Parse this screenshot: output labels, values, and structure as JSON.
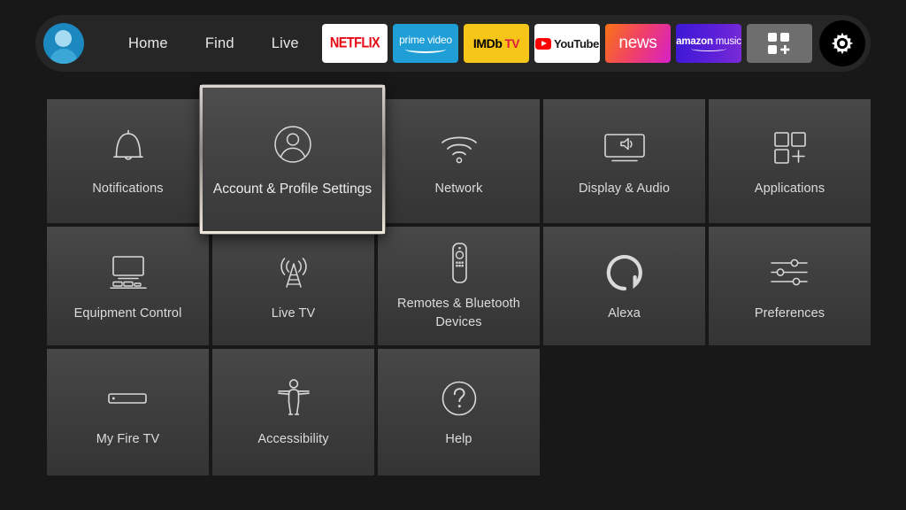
{
  "nav": {
    "avatar_name": "profile-avatar",
    "links": [
      {
        "label": "Home"
      },
      {
        "label": "Find"
      },
      {
        "label": "Live"
      }
    ],
    "apps": [
      {
        "name": "netflix",
        "label": "NETFLIX"
      },
      {
        "name": "prime-video",
        "label": "prime video"
      },
      {
        "name": "imdb-tv",
        "label_a": "IMDb",
        "label_b": "TV"
      },
      {
        "name": "youtube",
        "label": "YouTube"
      },
      {
        "name": "news",
        "label": "news"
      },
      {
        "name": "amazon-music",
        "label_a": "amazon",
        "label_b": "music"
      },
      {
        "name": "app-library",
        "label": ""
      },
      {
        "name": "settings-gear",
        "label": ""
      }
    ]
  },
  "grid": {
    "rows": [
      [
        {
          "icon": "bell-icon",
          "label": "Notifications"
        },
        {
          "icon": "person-circle-icon",
          "label": "Account & Profile Settings",
          "selected": true
        },
        {
          "icon": "wifi-icon",
          "label": "Network"
        },
        {
          "icon": "tv-speaker-icon",
          "label": "Display & Audio"
        },
        {
          "icon": "apps-grid-plus-icon",
          "label": "Applications"
        }
      ],
      [
        {
          "icon": "monitor-devices-icon",
          "label": "Equipment Control"
        },
        {
          "icon": "broadcast-tower-icon",
          "label": "Live TV"
        },
        {
          "icon": "remote-control-icon",
          "label": "Remotes & Bluetooth Devices"
        },
        {
          "icon": "alexa-ring-icon",
          "label": "Alexa"
        },
        {
          "icon": "sliders-icon",
          "label": "Preferences"
        }
      ],
      [
        {
          "icon": "fire-tv-stick-icon",
          "label": "My Fire TV"
        },
        {
          "icon": "accessibility-person-icon",
          "label": "Accessibility"
        },
        {
          "icon": "question-circle-icon",
          "label": "Help"
        },
        {
          "icon": "",
          "label": ""
        },
        {
          "icon": "",
          "label": ""
        }
      ]
    ]
  },
  "colors": {
    "background": "#181818",
    "navbar": "#262626",
    "tile": "#3f3f3f",
    "tile_text": "#dcdcdc",
    "selection_border": "#d8d4cf",
    "netflix_red": "#e50914",
    "prime_blue": "#1f9fd6",
    "imdb_yellow": "#f5c518",
    "youtube_red": "#ff0000",
    "avatar_blue": "#1b88c0"
  }
}
